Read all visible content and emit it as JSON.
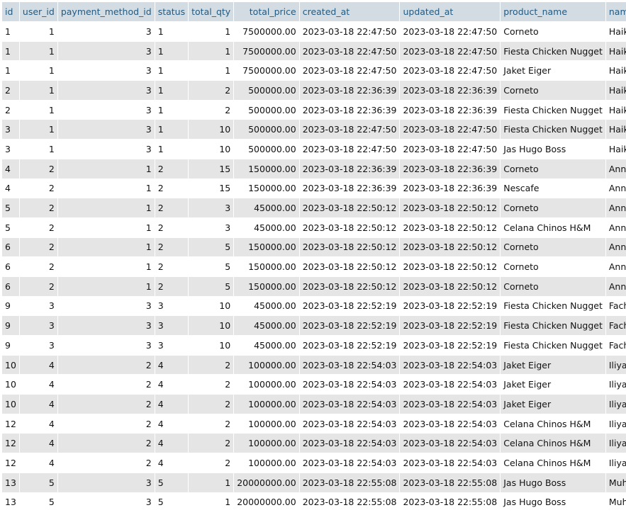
{
  "columns": [
    {
      "key": "id",
      "label": "id"
    },
    {
      "key": "user_id",
      "label": "user_id"
    },
    {
      "key": "payment_method_id",
      "label": "payment_method_id"
    },
    {
      "key": "status",
      "label": "status"
    },
    {
      "key": "total_qty",
      "label": "total_qty"
    },
    {
      "key": "total_price",
      "label": "total_price"
    },
    {
      "key": "created_at",
      "label": "created_at"
    },
    {
      "key": "updated_at",
      "label": "updated_at"
    },
    {
      "key": "product_name",
      "label": "product_name"
    },
    {
      "key": "name",
      "label": "name"
    }
  ],
  "rows": [
    {
      "id": "1",
      "user_id": "1",
      "payment_method_id": "3",
      "status": "1",
      "total_qty": "1",
      "total_price": "7500000.00",
      "created_at": "2023-03-18 22:47:50",
      "updated_at": "2023-03-18 22:47:50",
      "product_name": "Corneto",
      "name": "Haikal"
    },
    {
      "id": "1",
      "user_id": "1",
      "payment_method_id": "3",
      "status": "1",
      "total_qty": "1",
      "total_price": "7500000.00",
      "created_at": "2023-03-18 22:47:50",
      "updated_at": "2023-03-18 22:47:50",
      "product_name": "Fiesta Chicken Nugget",
      "name": "Haikal"
    },
    {
      "id": "1",
      "user_id": "1",
      "payment_method_id": "3",
      "status": "1",
      "total_qty": "1",
      "total_price": "7500000.00",
      "created_at": "2023-03-18 22:47:50",
      "updated_at": "2023-03-18 22:47:50",
      "product_name": "Jaket Eiger",
      "name": "Haikal"
    },
    {
      "id": "2",
      "user_id": "1",
      "payment_method_id": "3",
      "status": "1",
      "total_qty": "2",
      "total_price": "500000.00",
      "created_at": "2023-03-18 22:36:39",
      "updated_at": "2023-03-18 22:36:39",
      "product_name": "Corneto",
      "name": "Haikal"
    },
    {
      "id": "2",
      "user_id": "1",
      "payment_method_id": "3",
      "status": "1",
      "total_qty": "2",
      "total_price": "500000.00",
      "created_at": "2023-03-18 22:36:39",
      "updated_at": "2023-03-18 22:36:39",
      "product_name": "Fiesta Chicken Nugget",
      "name": "Haikal"
    },
    {
      "id": "3",
      "user_id": "1",
      "payment_method_id": "3",
      "status": "1",
      "total_qty": "10",
      "total_price": "500000.00",
      "created_at": "2023-03-18 22:47:50",
      "updated_at": "2023-03-18 22:47:50",
      "product_name": "Fiesta Chicken Nugget",
      "name": "Haikal"
    },
    {
      "id": "3",
      "user_id": "1",
      "payment_method_id": "3",
      "status": "1",
      "total_qty": "10",
      "total_price": "500000.00",
      "created_at": "2023-03-18 22:47:50",
      "updated_at": "2023-03-18 22:47:50",
      "product_name": "Jas Hugo Boss",
      "name": "Haikal"
    },
    {
      "id": "4",
      "user_id": "2",
      "payment_method_id": "1",
      "status": "2",
      "total_qty": "15",
      "total_price": "150000.00",
      "created_at": "2023-03-18 22:36:39",
      "updated_at": "2023-03-18 22:36:39",
      "product_name": "Corneto",
      "name": "Anna"
    },
    {
      "id": "4",
      "user_id": "2",
      "payment_method_id": "1",
      "status": "2",
      "total_qty": "15",
      "total_price": "150000.00",
      "created_at": "2023-03-18 22:36:39",
      "updated_at": "2023-03-18 22:36:39",
      "product_name": "Nescafe",
      "name": "Anna"
    },
    {
      "id": "5",
      "user_id": "2",
      "payment_method_id": "1",
      "status": "2",
      "total_qty": "3",
      "total_price": "45000.00",
      "created_at": "2023-03-18 22:50:12",
      "updated_at": "2023-03-18 22:50:12",
      "product_name": "Corneto",
      "name": "Anna"
    },
    {
      "id": "5",
      "user_id": "2",
      "payment_method_id": "1",
      "status": "2",
      "total_qty": "3",
      "total_price": "45000.00",
      "created_at": "2023-03-18 22:50:12",
      "updated_at": "2023-03-18 22:50:12",
      "product_name": "Celana Chinos H&M",
      "name": "Anna"
    },
    {
      "id": "6",
      "user_id": "2",
      "payment_method_id": "1",
      "status": "2",
      "total_qty": "5",
      "total_price": "150000.00",
      "created_at": "2023-03-18 22:50:12",
      "updated_at": "2023-03-18 22:50:12",
      "product_name": "Corneto",
      "name": "Anna"
    },
    {
      "id": "6",
      "user_id": "2",
      "payment_method_id": "1",
      "status": "2",
      "total_qty": "5",
      "total_price": "150000.00",
      "created_at": "2023-03-18 22:50:12",
      "updated_at": "2023-03-18 22:50:12",
      "product_name": "Corneto",
      "name": "Anna"
    },
    {
      "id": "6",
      "user_id": "2",
      "payment_method_id": "1",
      "status": "2",
      "total_qty": "5",
      "total_price": "150000.00",
      "created_at": "2023-03-18 22:50:12",
      "updated_at": "2023-03-18 22:50:12",
      "product_name": "Corneto",
      "name": "Anna"
    },
    {
      "id": "9",
      "user_id": "3",
      "payment_method_id": "3",
      "status": "3",
      "total_qty": "10",
      "total_price": "45000.00",
      "created_at": "2023-03-18 22:52:19",
      "updated_at": "2023-03-18 22:52:19",
      "product_name": "Fiesta Chicken Nugget",
      "name": "Fachri"
    },
    {
      "id": "9",
      "user_id": "3",
      "payment_method_id": "3",
      "status": "3",
      "total_qty": "10",
      "total_price": "45000.00",
      "created_at": "2023-03-18 22:52:19",
      "updated_at": "2023-03-18 22:52:19",
      "product_name": "Fiesta Chicken Nugget",
      "name": "Fachri"
    },
    {
      "id": "9",
      "user_id": "3",
      "payment_method_id": "3",
      "status": "3",
      "total_qty": "10",
      "total_price": "45000.00",
      "created_at": "2023-03-18 22:52:19",
      "updated_at": "2023-03-18 22:52:19",
      "product_name": "Fiesta Chicken Nugget",
      "name": "Fachri"
    },
    {
      "id": "10",
      "user_id": "4",
      "payment_method_id": "2",
      "status": "4",
      "total_qty": "2",
      "total_price": "100000.00",
      "created_at": "2023-03-18 22:54:03",
      "updated_at": "2023-03-18 22:54:03",
      "product_name": "Jaket Eiger",
      "name": "Iliyana"
    },
    {
      "id": "10",
      "user_id": "4",
      "payment_method_id": "2",
      "status": "4",
      "total_qty": "2",
      "total_price": "100000.00",
      "created_at": "2023-03-18 22:54:03",
      "updated_at": "2023-03-18 22:54:03",
      "product_name": "Jaket Eiger",
      "name": "Iliyana"
    },
    {
      "id": "10",
      "user_id": "4",
      "payment_method_id": "2",
      "status": "4",
      "total_qty": "2",
      "total_price": "100000.00",
      "created_at": "2023-03-18 22:54:03",
      "updated_at": "2023-03-18 22:54:03",
      "product_name": "Jaket Eiger",
      "name": "Iliyana"
    },
    {
      "id": "12",
      "user_id": "4",
      "payment_method_id": "2",
      "status": "4",
      "total_qty": "2",
      "total_price": "100000.00",
      "created_at": "2023-03-18 22:54:03",
      "updated_at": "2023-03-18 22:54:03",
      "product_name": "Celana Chinos H&M",
      "name": "Iliyana"
    },
    {
      "id": "12",
      "user_id": "4",
      "payment_method_id": "2",
      "status": "4",
      "total_qty": "2",
      "total_price": "100000.00",
      "created_at": "2023-03-18 22:54:03",
      "updated_at": "2023-03-18 22:54:03",
      "product_name": "Celana Chinos H&M",
      "name": "Iliyana"
    },
    {
      "id": "12",
      "user_id": "4",
      "payment_method_id": "2",
      "status": "4",
      "total_qty": "2",
      "total_price": "100000.00",
      "created_at": "2023-03-18 22:54:03",
      "updated_at": "2023-03-18 22:54:03",
      "product_name": "Celana Chinos H&M",
      "name": "Iliyana"
    },
    {
      "id": "13",
      "user_id": "5",
      "payment_method_id": "3",
      "status": "5",
      "total_qty": "1",
      "total_price": "20000000.00",
      "created_at": "2023-03-18 22:55:08",
      "updated_at": "2023-03-18 22:55:08",
      "product_name": "Jas Hugo Boss",
      "name": "Muhamad"
    },
    {
      "id": "13",
      "user_id": "5",
      "payment_method_id": "3",
      "status": "5",
      "total_qty": "1",
      "total_price": "20000000.00",
      "created_at": "2023-03-18 22:55:08",
      "updated_at": "2023-03-18 22:55:08",
      "product_name": "Jas Hugo Boss",
      "name": "Muhamad"
    }
  ],
  "colors": {
    "header_bg": "#d3dce3",
    "header_text": "#235a81",
    "row_odd": "#ffffff",
    "row_even": "#e5e5e5"
  }
}
